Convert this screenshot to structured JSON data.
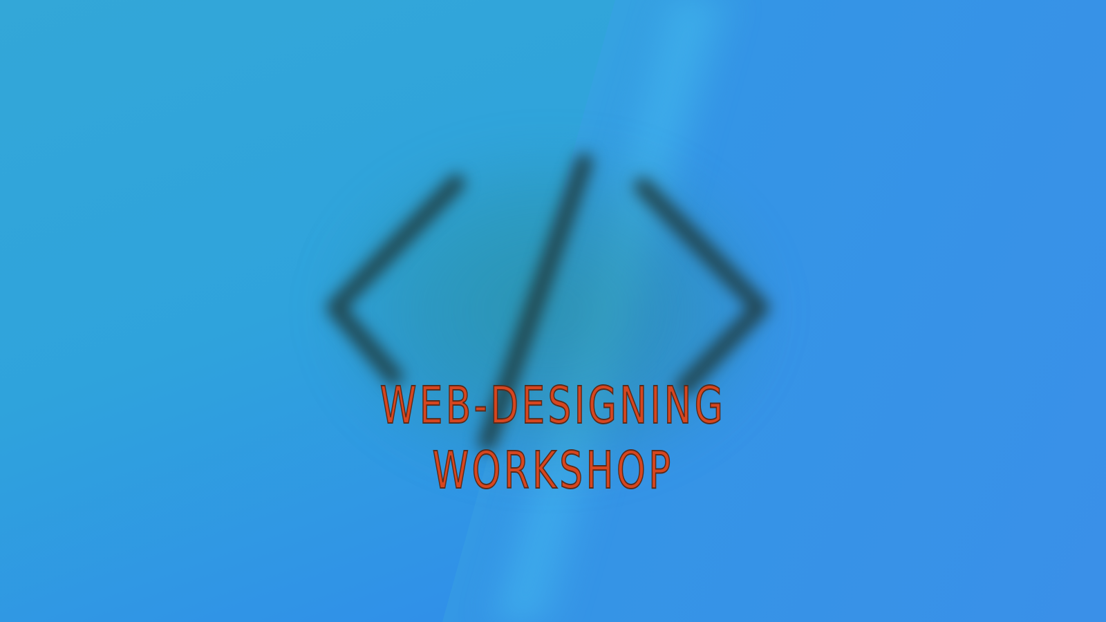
{
  "background": {
    "colors": {
      "left": "#2f86ea",
      "center": "#35a2e1",
      "right": "#3a90e8",
      "glow": "#288c8c"
    }
  },
  "logo": {
    "icon": "code-brackets-icon",
    "stroke_color": "#1e3a3c"
  },
  "title": {
    "line1": "WEB-DESIGNING",
    "line2": "WORKSHOP",
    "color": "#d7461f"
  }
}
